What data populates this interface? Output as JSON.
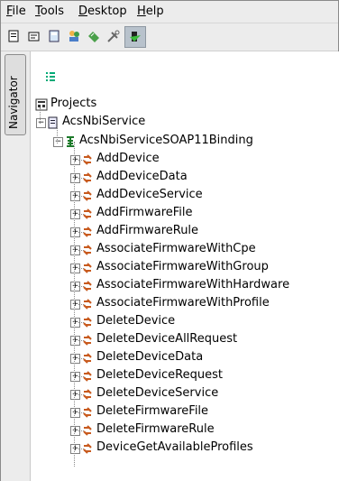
{
  "menu": [
    {
      "label": "File",
      "mnemonic": "F"
    },
    {
      "label": "Tools",
      "mnemonic": "T"
    },
    {
      "label": "Desktop",
      "mnemonic": "D"
    },
    {
      "label": "Help",
      "mnemonic": "H"
    }
  ],
  "toolbar": [
    "new-project-icon",
    "open-project-icon",
    "save-icon",
    "users-icon",
    "validate-icon",
    "tools-icon",
    "run-icon"
  ],
  "navigator": {
    "tab_label": "Navigator"
  },
  "tree": {
    "root": "Projects",
    "service": "AcsNbiService",
    "binding": "AcsNbiServiceSOAP11Binding",
    "operations": [
      "AddDevice",
      "AddDeviceData",
      "AddDeviceService",
      "AddFirmwareFile",
      "AddFirmwareRule",
      "AssociateFirmwareWithCpe",
      "AssociateFirmwareWithGroup",
      "AssociateFirmwareWithHardware",
      "AssociateFirmwareWithProfile",
      "DeleteDevice",
      "DeleteDeviceAllRequest",
      "DeleteDeviceData",
      "DeleteDeviceRequest",
      "DeleteDeviceService",
      "DeleteFirmwareFile",
      "DeleteFirmwareRule",
      "DeviceGetAvailableProfiles"
    ]
  }
}
